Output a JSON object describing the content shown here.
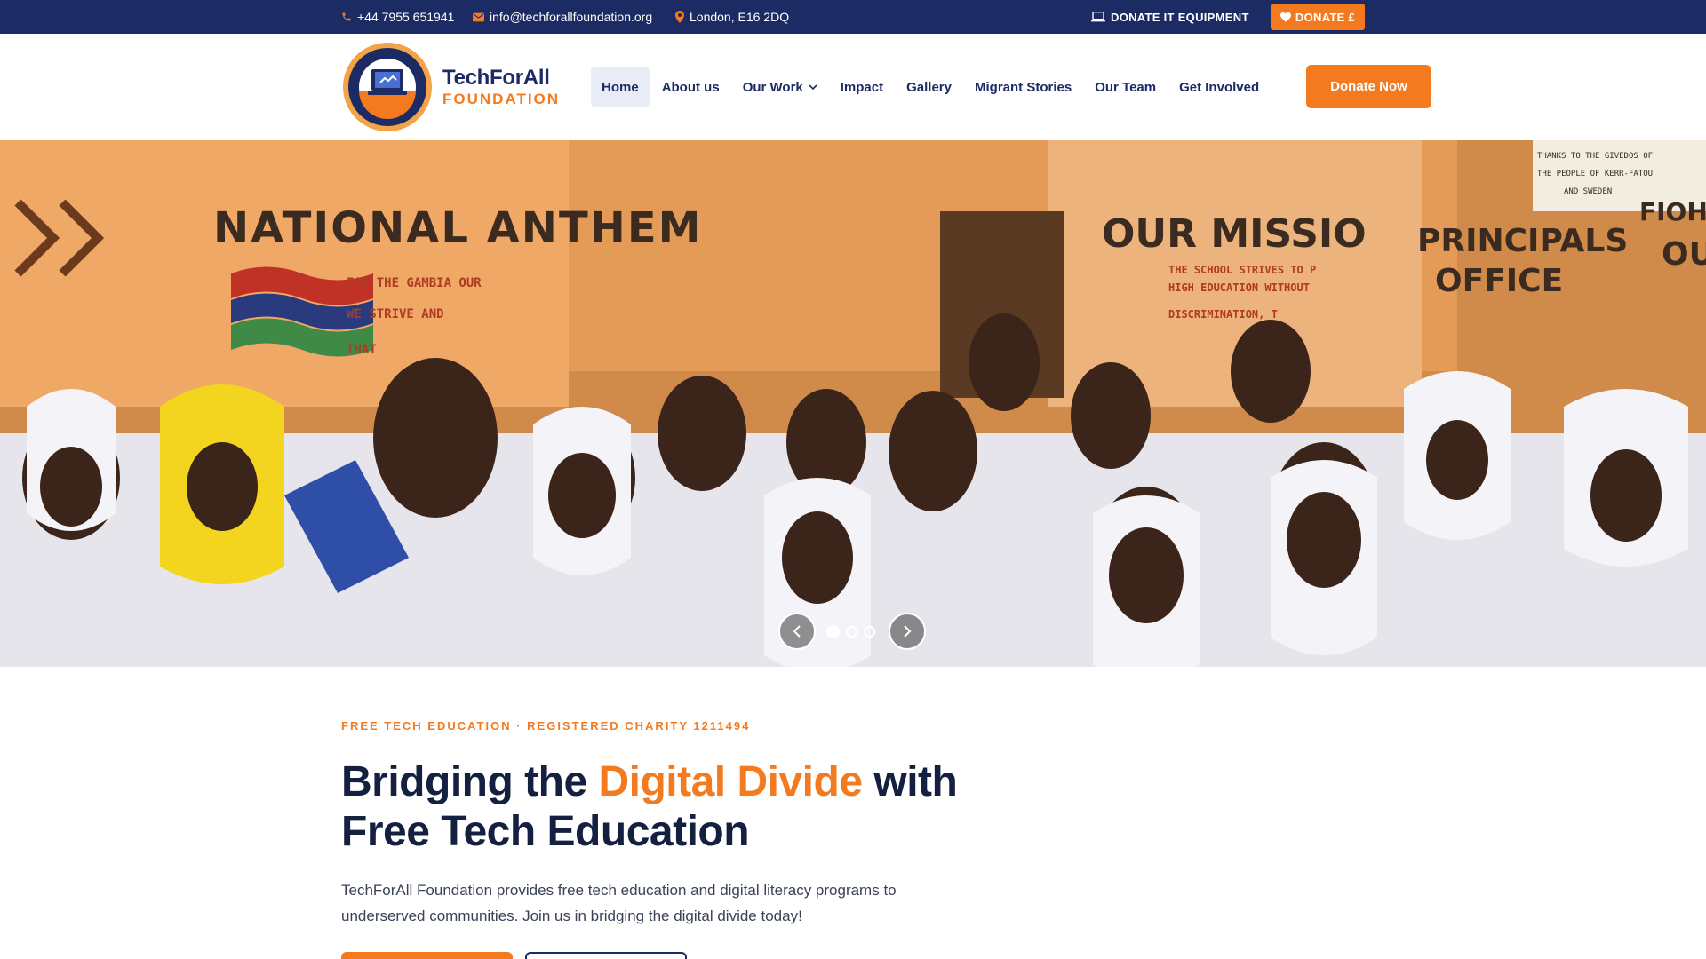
{
  "topbar": {
    "phone": "+44 7955 651941",
    "email": "info@techforallfoundation.org",
    "location": "London, E16 2DQ",
    "donate_it_label": "DONATE IT EQUIPMENT",
    "donate_money_label": "DONATE £"
  },
  "header": {
    "logo_name": "TechForAll",
    "logo_sub": "FOUNDATION",
    "logo_ring_text": "TECHFORALL FOUNDATION",
    "nav": [
      {
        "label": "Home",
        "active": true
      },
      {
        "label": "About us"
      },
      {
        "label": "Our Work",
        "dropdown": true
      },
      {
        "label": "Impact"
      },
      {
        "label": "Gallery"
      },
      {
        "label": "Migrant Stories"
      },
      {
        "label": "Our Team"
      },
      {
        "label": "Get Involved"
      }
    ],
    "donate_now_label": "Donate Now"
  },
  "hero": {
    "signs": {
      "anthem": "NATIONAL ANTHEM",
      "anthem_line1": "FOR THE GAMBIA OUR",
      "anthem_line2": "WE STRIVE AND",
      "anthem_line3": "THAT",
      "mission": "OUR MISSIO",
      "mission_line1": "THE SCHOOL STRIVES TO P",
      "mission_line2": "HIGH EDUCATION WITHOUT",
      "mission_line3": "DISCRIMINATION, T",
      "principal_line1": "PRINCIPALS",
      "principal_line2": "OFFICE",
      "notice_line1": "THANKS TO THE GIVEDOS OF",
      "notice_line2": "THE PEOPLE OF KERR-FATOU",
      "notice_line3": "AND SWEDEN",
      "fioh": "FIOH",
      "edge": "OUI"
    },
    "slides_total": 3,
    "slide_active": 1
  },
  "intro": {
    "eyebrow": "FREE TECH EDUCATION · REGISTERED CHARITY 1211494",
    "headline_part1": "Bridging the ",
    "headline_accent": "Digital Divide",
    "headline_part2": " with Free Tech Education",
    "lede": "TechForAll Foundation provides free tech education and digital literacy programs to underserved communities. Join us in bridging the digital divide today!"
  },
  "colors": {
    "navy": "#1c2b63",
    "orange": "#f47a20",
    "headline": "#14203f",
    "nav_active_bg": "#e8ecf6"
  },
  "icons": {
    "phone": "phone-icon",
    "email": "envelope-icon",
    "location": "map-pin-icon",
    "laptop": "laptop-icon",
    "heart": "heart-icon",
    "dropdown": "chevron-down-icon",
    "prev": "chevron-left-icon",
    "next": "chevron-right-icon"
  }
}
